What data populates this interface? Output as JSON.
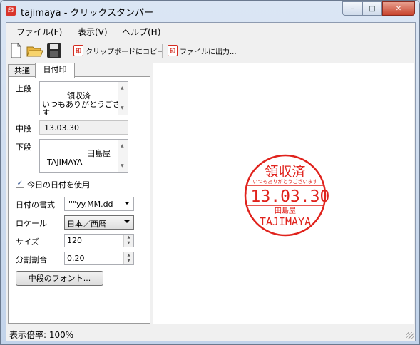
{
  "window": {
    "title": "tajimaya - クリックスタンパー",
    "app_icon_text": "印"
  },
  "caption": {
    "minimize": "–",
    "maximize": "□",
    "close": "✕"
  },
  "menu": {
    "file": "ファイル(F)",
    "view": "表示(V)",
    "help": "ヘルプ(H)"
  },
  "toolbar": {
    "copy_label": "クリップボードにコピー",
    "export_label": "ファイルに出力...",
    "stamp_icon_text": "印"
  },
  "tabs": {
    "common": "共通",
    "date_stamp": "日付印"
  },
  "form": {
    "upper_label": "上段",
    "upper_value": "領収済\nいつもありがとうございま\nす",
    "middle_label": "中段",
    "middle_value": "'13.03.30",
    "lower_label": "下段",
    "lower_value": "        田島屋\n  TAJIMAYA",
    "use_today_label": "今日の日付を使用",
    "use_today_checked": true,
    "date_format_label": "日付の書式",
    "date_format_value": "\"'\"yy.MM.dd",
    "locale_label": "ロケール",
    "locale_value": "日本／西暦",
    "size_label": "サイズ",
    "size_value": "120",
    "ratio_label": "分割割合",
    "ratio_value": "0.20",
    "font_button": "中段のフォント..."
  },
  "stamp": {
    "top_text": "領収済",
    "top_small": "いつもありがとうございます",
    "date_text": "'13.03.30",
    "bottom_small": "田島屋",
    "bottom_text": "TAJIMAYA",
    "color": "#e0231d"
  },
  "status": {
    "text": "表示倍率: 100%"
  }
}
